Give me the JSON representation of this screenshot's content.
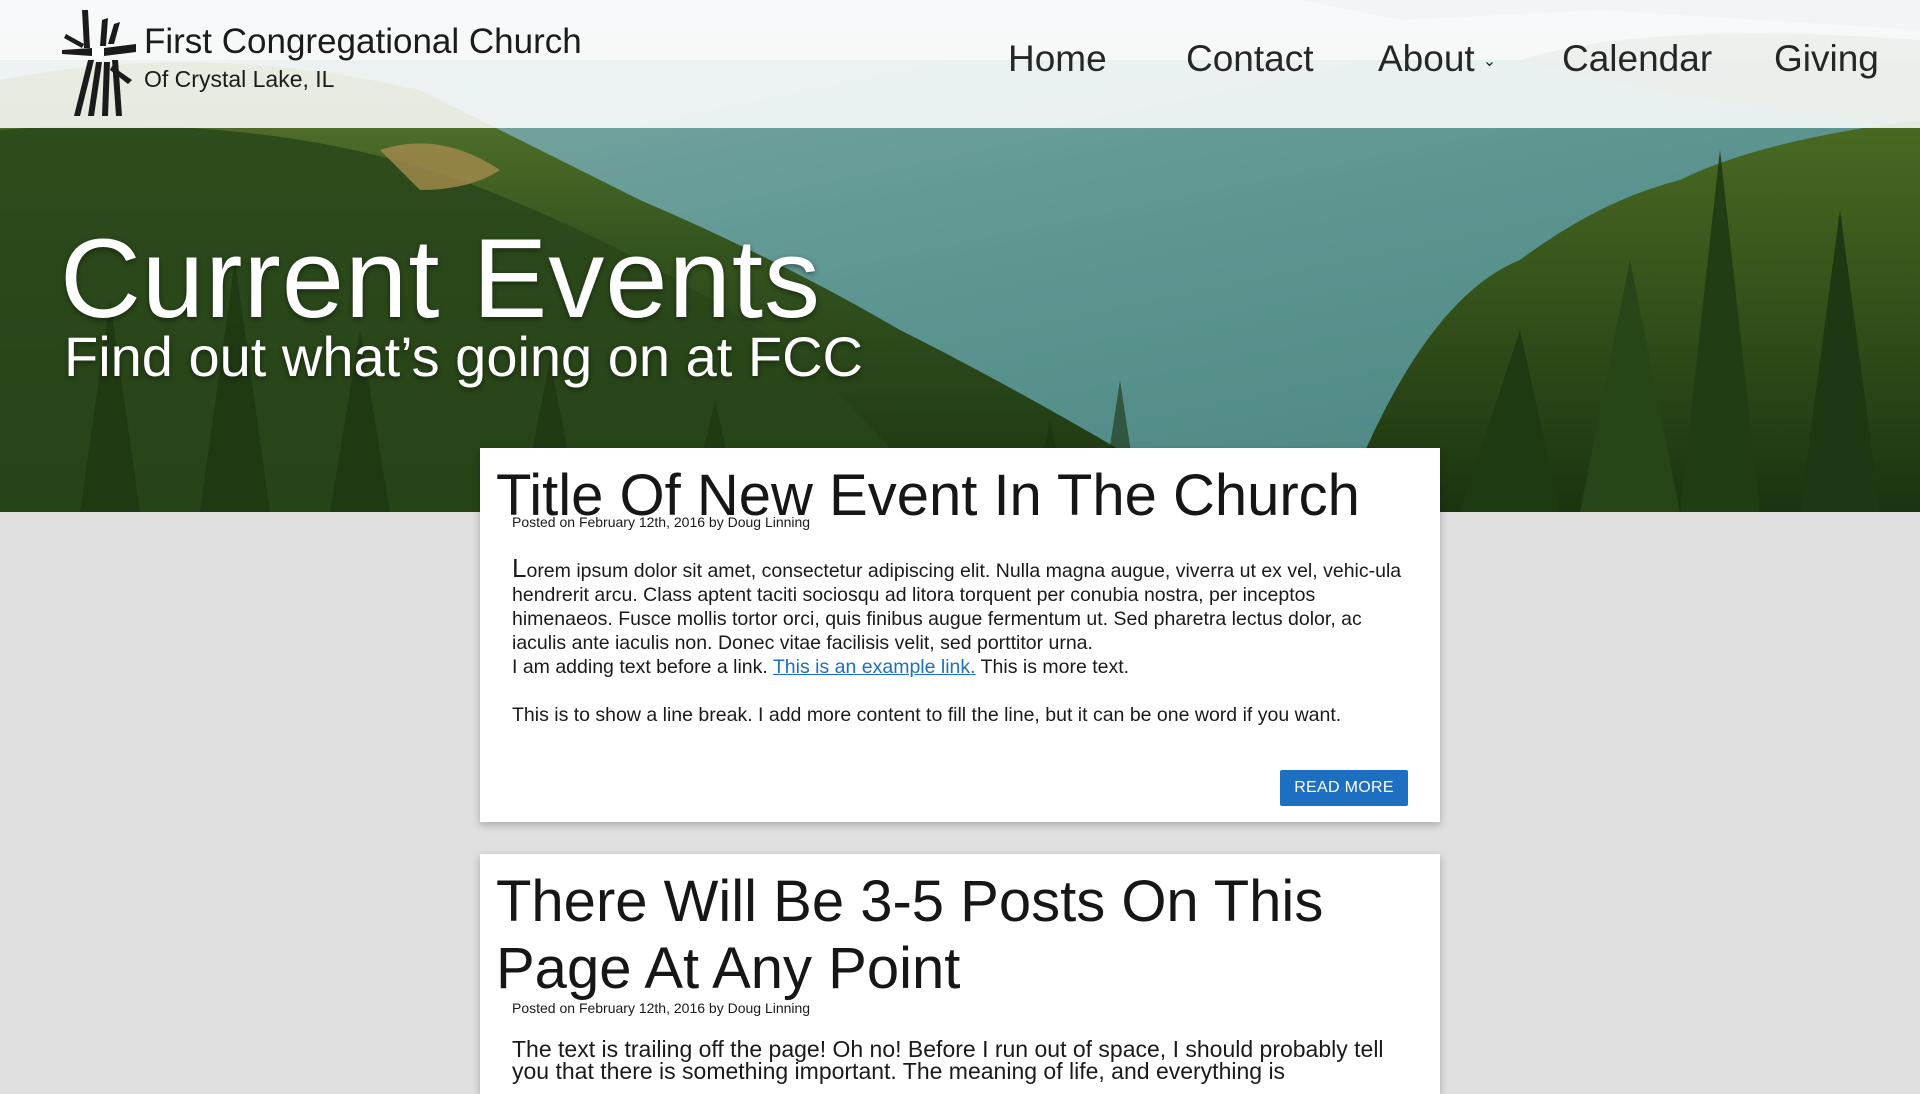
{
  "brand": {
    "title": "First Congregational Church",
    "subtitle": "Of Crystal Lake, IL",
    "logo_icon": "cross-logo-icon"
  },
  "nav": {
    "items": [
      {
        "label": "Home"
      },
      {
        "label": "Contact"
      },
      {
        "label": "About",
        "has_dropdown": true,
        "dropdown_icon": "chevron-down-icon"
      },
      {
        "label": "Calendar"
      },
      {
        "label": "Giving"
      }
    ]
  },
  "hero": {
    "title": "Current Events",
    "subtitle": "Find out what’s going on at FCC"
  },
  "posts": [
    {
      "title": "Title Of New Event In The Church",
      "meta": "Posted on February 12th, 2016 by Doug Linning",
      "dropcap": "L",
      "paragraph_1": "orem ipsum dolor sit amet, consectetur adipiscing elit. Nulla magna augue, viverra ut ex vel, vehic-ula hendrerit arcu. Class aptent taciti sociosqu ad litora torquent per conubia nostra, per inceptos himenaeos. Fusce mollis tortor orci, quis finibus augue fermentum ut. Sed pharetra lectus dolor, ac iaculis ante iaculis non. Donec vitae facilisis velit, sed porttitor urna.",
      "link_before": "I am adding text before a link. ",
      "link_text": "This is an example link.",
      "link_after": " This is more text.",
      "paragraph_2": "This is to show a line break. I add more content to fill the line, but it can be one word if you want.",
      "button_label": "READ MORE"
    },
    {
      "title": "There Will Be 3-5 Posts On This Page At Any Point",
      "meta": "Posted on February 12th, 2016 by Doug Linning",
      "paragraph_1": "The text is trailing off the page! Oh no! Before I run out of space, I should probably tell you that there is something important. The meaning of life, and everything is"
    }
  ],
  "colors": {
    "accent": "#1d6fc1",
    "page_bg": "#e0e0e0",
    "header_bg": "#ffffff"
  }
}
